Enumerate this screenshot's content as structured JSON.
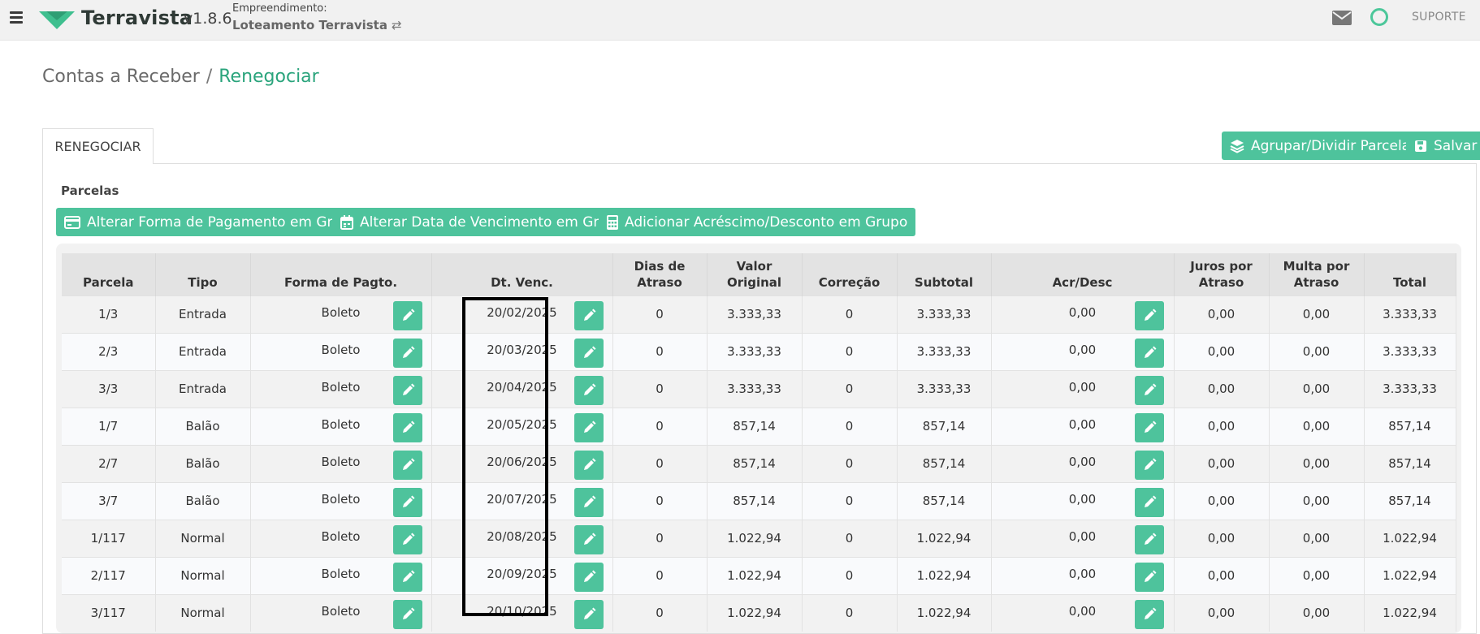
{
  "header": {
    "brand": "Terravista",
    "version": "v1.8.6",
    "empreendimento_label": "Empreendimento:",
    "empreendimento_name": "Loteamento Terravista",
    "swap_glyph": "⇄",
    "suporte_label": "SUPORTE",
    "brand_color": "#4ec39c"
  },
  "breadcrumb": {
    "parent": "Contas a Receber",
    "separator": "/",
    "current": "Renegociar"
  },
  "tab": {
    "label": "RENEGOCIAR"
  },
  "actions": {
    "group_split": "Agrupar/Dividir Parcelas",
    "save": "Salvar"
  },
  "section": {
    "title": "Parcelas"
  },
  "group_buttons": {
    "payment": "Alterar Forma de Pagamento em Grupo",
    "due_date": "Alterar Data de Vencimento em Grupo",
    "adjust": "Adicionar Acréscimo/Desconto em Grupo"
  },
  "table": {
    "headers": {
      "parcela": "Parcela",
      "tipo": "Tipo",
      "forma": "Forma de Pagto.",
      "venc": "Dt. Venc.",
      "dias": "Dias de Atraso",
      "valor": "Valor Original",
      "correcao": "Correção",
      "subtotal": "Subtotal",
      "acr": "Acr/Desc",
      "juros": "Juros por Atraso",
      "multa": "Multa por Atraso",
      "total": "Total"
    },
    "rows": [
      {
        "parcela": "1/3",
        "tipo": "Entrada",
        "forma": "Boleto",
        "venc": "20/02/2025",
        "dias": "0",
        "valor": "3.333,33",
        "correcao": "0",
        "subtotal": "3.333,33",
        "acr": "0,00",
        "juros": "0,00",
        "multa": "0,00",
        "total": "3.333,33"
      },
      {
        "parcela": "2/3",
        "tipo": "Entrada",
        "forma": "Boleto",
        "venc": "20/03/2025",
        "dias": "0",
        "valor": "3.333,33",
        "correcao": "0",
        "subtotal": "3.333,33",
        "acr": "0,00",
        "juros": "0,00",
        "multa": "0,00",
        "total": "3.333,33"
      },
      {
        "parcela": "3/3",
        "tipo": "Entrada",
        "forma": "Boleto",
        "venc": "20/04/2025",
        "dias": "0",
        "valor": "3.333,33",
        "correcao": "0",
        "subtotal": "3.333,33",
        "acr": "0,00",
        "juros": "0,00",
        "multa": "0,00",
        "total": "3.333,33"
      },
      {
        "parcela": "1/7",
        "tipo": "Balão",
        "forma": "Boleto",
        "venc": "20/05/2025",
        "dias": "0",
        "valor": "857,14",
        "correcao": "0",
        "subtotal": "857,14",
        "acr": "0,00",
        "juros": "0,00",
        "multa": "0,00",
        "total": "857,14"
      },
      {
        "parcela": "2/7",
        "tipo": "Balão",
        "forma": "Boleto",
        "venc": "20/06/2025",
        "dias": "0",
        "valor": "857,14",
        "correcao": "0",
        "subtotal": "857,14",
        "acr": "0,00",
        "juros": "0,00",
        "multa": "0,00",
        "total": "857,14"
      },
      {
        "parcela": "3/7",
        "tipo": "Balão",
        "forma": "Boleto",
        "venc": "20/07/2025",
        "dias": "0",
        "valor": "857,14",
        "correcao": "0",
        "subtotal": "857,14",
        "acr": "0,00",
        "juros": "0,00",
        "multa": "0,00",
        "total": "857,14"
      },
      {
        "parcela": "1/117",
        "tipo": "Normal",
        "forma": "Boleto",
        "venc": "20/08/2025",
        "dias": "0",
        "valor": "1.022,94",
        "correcao": "0",
        "subtotal": "1.022,94",
        "acr": "0,00",
        "juros": "0,00",
        "multa": "0,00",
        "total": "1.022,94"
      },
      {
        "parcela": "2/117",
        "tipo": "Normal",
        "forma": "Boleto",
        "venc": "20/09/2025",
        "dias": "0",
        "valor": "1.022,94",
        "correcao": "0",
        "subtotal": "1.022,94",
        "acr": "0,00",
        "juros": "0,00",
        "multa": "0,00",
        "total": "1.022,94"
      },
      {
        "parcela": "3/117",
        "tipo": "Normal",
        "forma": "Boleto",
        "venc": "20/10/2025",
        "dias": "0",
        "valor": "1.022,94",
        "correcao": "0",
        "subtotal": "1.022,94",
        "acr": "0,00",
        "juros": "0,00",
        "multa": "0,00",
        "total": "1.022,94"
      }
    ]
  }
}
